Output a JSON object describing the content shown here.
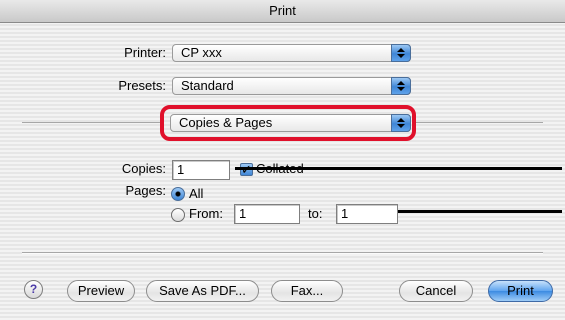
{
  "window": {
    "title": "Print"
  },
  "printer": {
    "label": "Printer:",
    "value": "CP xxx"
  },
  "presets": {
    "label": "Presets:",
    "value": "Standard"
  },
  "panel": {
    "value": "Copies & Pages"
  },
  "copies": {
    "label": "Copies:",
    "value": "1",
    "collated_label": "Collated",
    "collated_checked": true
  },
  "pages": {
    "label": "Pages:",
    "all_label": "All",
    "all_selected": true,
    "from_label": "From:",
    "from_value": "1",
    "to_label": "to:",
    "to_value": "1"
  },
  "buttons": {
    "help": "?",
    "preview": "Preview",
    "save_pdf": "Save As PDF...",
    "fax": "Fax...",
    "cancel": "Cancel",
    "print": "Print"
  },
  "colors": {
    "highlight": "#e0102b",
    "accent": "#3c8be2"
  }
}
